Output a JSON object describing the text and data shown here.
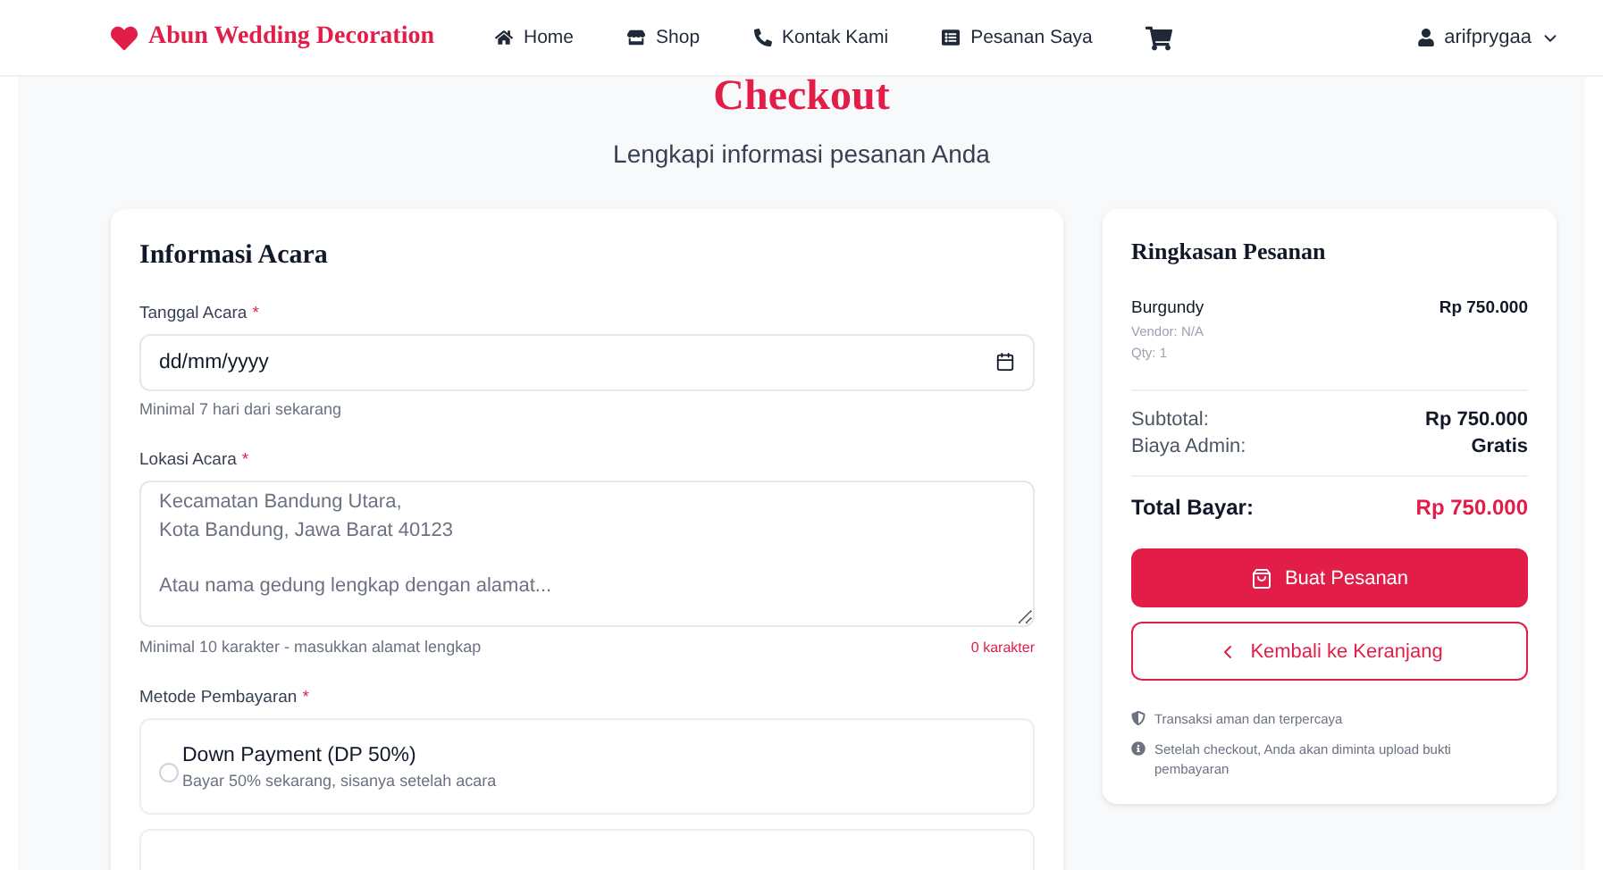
{
  "navbar": {
    "brand": "Abun Wedding Decoration",
    "links": [
      {
        "kind": "home",
        "label": "Home"
      },
      {
        "kind": "shop",
        "label": "Shop"
      },
      {
        "kind": "phone",
        "label": "Kontak Kami"
      },
      {
        "kind": "list",
        "label": "Pesanan Saya"
      }
    ],
    "user": "arifprygaa"
  },
  "header": {
    "title": "Checkout",
    "subtitle": "Lengkapi informasi pesanan Anda"
  },
  "event_form": {
    "title": "Informasi Acara",
    "date": {
      "label": "Tanggal Acara",
      "required_mark": "*",
      "placeholder": "dd/mm/yyyy",
      "hint": "Minimal 7 hari dari sekarang"
    },
    "location": {
      "label": "Lokasi Acara",
      "required_mark": "*",
      "placeholder": "Kecamatan Bandung Utara,\nKota Bandung, Jawa Barat 40123\n\nAtau nama gedung lengkap dengan alamat...",
      "hint": "Minimal 10 karakter - masukkan alamat lengkap",
      "counter": "0 karakter"
    },
    "payment": {
      "label": "Metode Pembayaran",
      "required_mark": "*",
      "options": [
        {
          "title": "Down Payment (DP 50%)",
          "description": "Bayar 50% sekarang, sisanya setelah acara",
          "selected": false
        }
      ]
    }
  },
  "summary": {
    "title": "Ringkasan Pesanan",
    "items": [
      {
        "name": "Burgundy",
        "price": "Rp 750.000",
        "vendor": "Vendor: N/A",
        "qty": "Qty: 1"
      }
    ],
    "subtotal": {
      "label": "Subtotal:",
      "value": "Rp 750.000"
    },
    "admin_fee": {
      "label": "Biaya Admin:",
      "value": "Gratis"
    },
    "total": {
      "label": "Total Bayar:",
      "value": "Rp 750.000"
    },
    "primary_button": "Buat Pesanan",
    "secondary_button": "Kembali ke Keranjang",
    "notes": [
      {
        "kind": "shield",
        "text": "Transaksi aman dan terpercaya"
      },
      {
        "kind": "info",
        "text": "Setelah checkout, Anda akan diminta upload bukti pembayaran"
      }
    ]
  }
}
